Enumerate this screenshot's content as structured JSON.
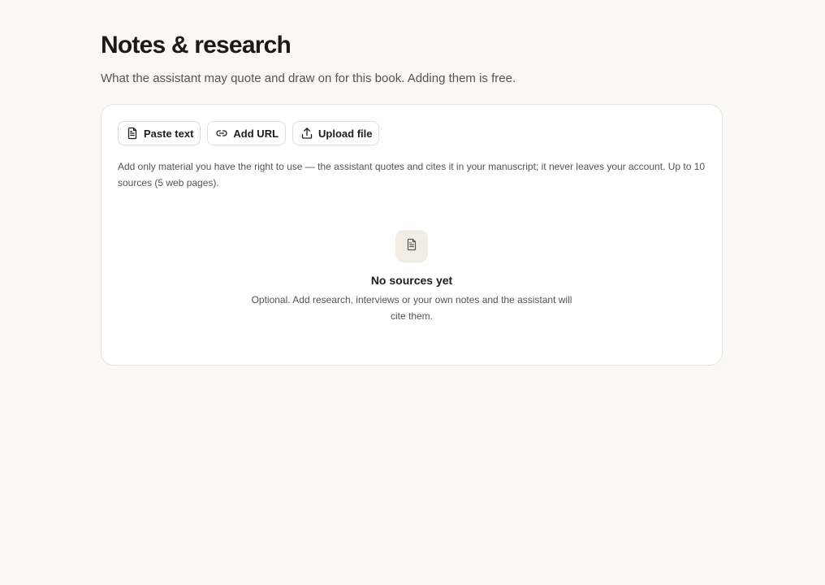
{
  "header": {
    "title": "Notes & research",
    "subtitle": "What the assistant may quote and draw on for this book. Adding them is free."
  },
  "toolbar": {
    "paste_text_label": "Paste text",
    "add_url_label": "Add URL",
    "upload_file_label": "Upload file"
  },
  "notice": {
    "text": "Add only material you have the right to use — the assistant quotes and cites it in your manuscript; it never leaves your account. Up to 10 sources (5 web pages)."
  },
  "empty_state": {
    "icon": "document-icon",
    "title": "No sources yet",
    "description": "Optional. Add research, interviews or your own notes and the assistant will cite them."
  },
  "colors": {
    "background": "#faf9f6",
    "card": "#ffffff",
    "border": "#e8e4dc",
    "icon_tile": "#f1ede5"
  }
}
